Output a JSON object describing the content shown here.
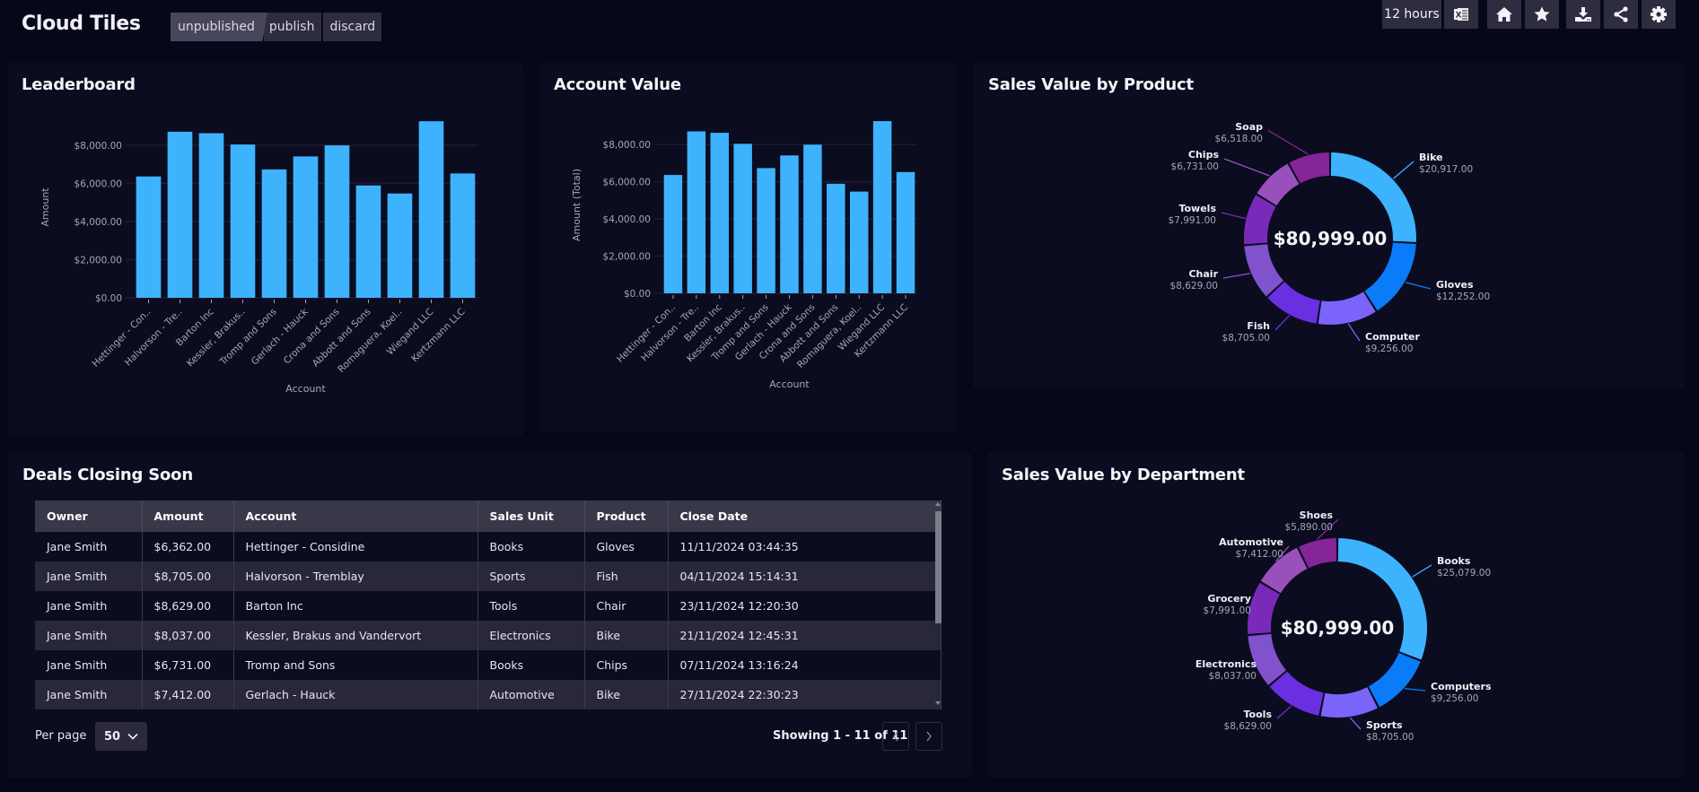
{
  "header": {
    "title": "Cloud Tiles",
    "status": "unpublished",
    "publish_label": "publish",
    "discard_label": "discard",
    "time_range": "12 hours",
    "icons": [
      "excel-export-icon",
      "home-icon",
      "star-icon",
      "download-icon",
      "share-icon",
      "settings-icon"
    ]
  },
  "colors": {
    "bar": "#3db3fe",
    "donut": [
      "#3db3fe",
      "#0a7cf9",
      "#7b64f9",
      "#6a2fe0",
      "#8052cc",
      "#7a2ab8",
      "#9a50bb",
      "#852598"
    ]
  },
  "leaderboard": {
    "title": "Leaderboard",
    "chart_data": {
      "type": "bar",
      "title": "Leaderboard",
      "xlabel": "Account",
      "ylabel": "Amount",
      "ylim": [
        0,
        9500
      ],
      "yticks": [
        "$0.00",
        "$2,000.00",
        "$4,000.00",
        "$6,000.00",
        "$8,000.00"
      ],
      "ytick_values": [
        0,
        2000,
        4000,
        6000,
        8000
      ],
      "grid": true,
      "categories": [
        "Hettinger - Con..",
        "Halvorson - Tre..",
        "Barton Inc",
        "Kessler, Brakus..",
        "Tromp and Sons",
        "Gerlach - Hauck",
        "Crona and Sons",
        "Abbott and Sons",
        "Romaguera, Koel..",
        "Wiegand LLC",
        "Kertzmann LLC"
      ],
      "values": [
        6362,
        8705,
        8629,
        8037,
        6731,
        7412,
        7991,
        5890,
        5468,
        9256,
        6518
      ]
    }
  },
  "account_value": {
    "title": "Account Value",
    "chart_data": {
      "type": "bar",
      "title": "Account Value",
      "xlabel": "Account",
      "ylabel": "Amount (Total)",
      "ylim": [
        0,
        9500
      ],
      "yticks": [
        "$0.00",
        "$2,000.00",
        "$4,000.00",
        "$6,000.00",
        "$8,000.00"
      ],
      "ytick_values": [
        0,
        2000,
        4000,
        6000,
        8000
      ],
      "grid": true,
      "categories": [
        "Hettinger - Con..",
        "Halvorson - Tre..",
        "Barton Inc",
        "Kessler, Brakus..",
        "Tromp and Sons",
        "Gerlach - Hauck",
        "Crona and Sons",
        "Abbott and Sons",
        "Romaguera, Koel..",
        "Wiegand LLC",
        "Kertzmann LLC"
      ],
      "values": [
        6362,
        8705,
        8629,
        8037,
        6731,
        7412,
        7991,
        5890,
        5468,
        9256,
        6518
      ]
    }
  },
  "sales_by_product": {
    "title": "Sales Value by Product",
    "chart_data": {
      "type": "pie",
      "donut": true,
      "center_label": "$80,999.00",
      "labels": [
        "Bike",
        "Gloves",
        "Computer",
        "Fish",
        "Chair",
        "Towels",
        "Chips",
        "Soap"
      ],
      "values": [
        20917,
        12252,
        9256,
        8705,
        8629,
        7991,
        6731,
        6518
      ],
      "value_labels": [
        "$20,917.00",
        "$12,252.00",
        "$9,256.00",
        "$8,705.00",
        "$8,629.00",
        "$7,991.00",
        "$6,731.00",
        "$6,518.00"
      ]
    }
  },
  "sales_by_department": {
    "title": "Sales Value by Department",
    "chart_data": {
      "type": "pie",
      "donut": true,
      "center_label": "$80,999.00",
      "labels": [
        "Books",
        "Computers",
        "Sports",
        "Tools",
        "Electronics",
        "Grocery",
        "Automotive",
        "Shoes"
      ],
      "values": [
        25079,
        9256,
        8705,
        8629,
        8037,
        7991,
        7412,
        5890
      ],
      "value_labels": [
        "$25,079.00",
        "$9,256.00",
        "$8,705.00",
        "$8,629.00",
        "$8,037.00",
        "$7,991.00",
        "$7,412.00",
        "$5,890.00"
      ]
    }
  },
  "deals": {
    "title": "Deals Closing Soon",
    "columns": [
      "Owner",
      "Amount",
      "Account",
      "Sales Unit",
      "Product",
      "Close Date"
    ],
    "rows": [
      [
        "Jane Smith",
        "$6,362.00",
        "Hettinger - Considine",
        "Books",
        "Gloves",
        "11/11/2024 03:44:35"
      ],
      [
        "Jane Smith",
        "$8,705.00",
        "Halvorson - Tremblay",
        "Sports",
        "Fish",
        "04/11/2024 15:14:31"
      ],
      [
        "Jane Smith",
        "$8,629.00",
        "Barton Inc",
        "Tools",
        "Chair",
        "23/11/2024 12:20:30"
      ],
      [
        "Jane Smith",
        "$8,037.00",
        "Kessler, Brakus and Vandervort",
        "Electronics",
        "Bike",
        "21/11/2024 12:45:31"
      ],
      [
        "Jane Smith",
        "$6,731.00",
        "Tromp and Sons",
        "Books",
        "Chips",
        "07/11/2024 13:16:24"
      ],
      [
        "Jane Smith",
        "$7,412.00",
        "Gerlach - Hauck",
        "Automotive",
        "Bike",
        "27/11/2024 22:30:23"
      ]
    ],
    "per_page_label": "Per page",
    "per_page_value": "50",
    "showing": "Showing 1 - 11 of 11"
  }
}
